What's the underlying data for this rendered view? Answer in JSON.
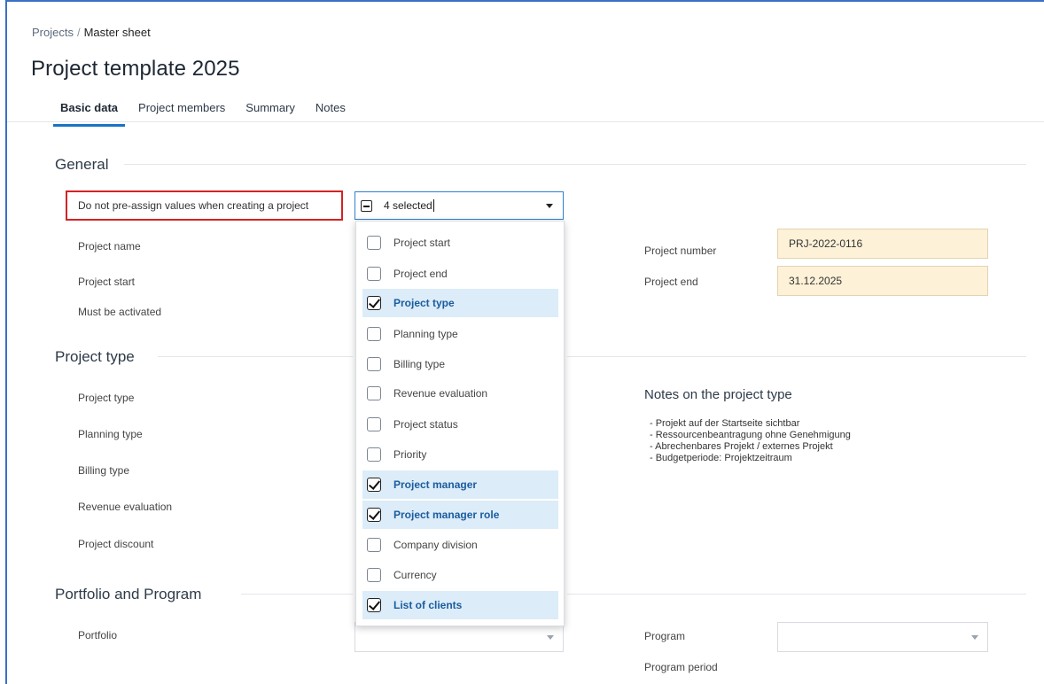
{
  "breadcrumb": {
    "parent": "Projects",
    "separator": "/",
    "current": "Master sheet"
  },
  "page_title": "Project template 2025",
  "tabs": [
    {
      "label": "Basic data",
      "active": true
    },
    {
      "label": "Project members",
      "active": false
    },
    {
      "label": "Summary",
      "active": false
    },
    {
      "label": "Notes",
      "active": false
    }
  ],
  "sections": {
    "general": {
      "title": "General",
      "preassign_label": "Do not pre-assign values when creating a project",
      "preassign_value": "4 selected",
      "project_name_label": "Project name",
      "project_start_label": "Project start",
      "must_be_activated_label": "Must be activated",
      "project_number_label": "Project number",
      "project_number_value": "PRJ-2022-0116",
      "project_end_label": "Project end",
      "project_end_value": "31.12.2025"
    },
    "project_type": {
      "title": "Project type",
      "project_type_label": "Project type",
      "planning_type_label": "Planning type",
      "billing_type_label": "Billing type",
      "revenue_evaluation_label": "Revenue evaluation",
      "project_discount_label": "Project discount",
      "notes_title": "Notes on the project type",
      "notes": [
        "- Projekt auf der Startseite sichtbar",
        "- Ressourcenbeantragung ohne Genehmigung",
        "- Abrechenbares Projekt / externes Projekt",
        "- Budgetperiode: Projektzeitraum"
      ]
    },
    "portfolio": {
      "title": "Portfolio and Program",
      "portfolio_label": "Portfolio",
      "program_label": "Program",
      "program_period_label": "Program period"
    }
  },
  "dropdown_options": [
    {
      "label": "Project start",
      "checked": false
    },
    {
      "label": "Project end",
      "checked": false
    },
    {
      "label": "Project type",
      "checked": true
    },
    {
      "label": "Planning type",
      "checked": false
    },
    {
      "label": "Billing type",
      "checked": false
    },
    {
      "label": "Revenue evaluation",
      "checked": false
    },
    {
      "label": "Project status",
      "checked": false
    },
    {
      "label": "Priority",
      "checked": false
    },
    {
      "label": "Project manager",
      "checked": true
    },
    {
      "label": "Project manager role",
      "checked": true
    },
    {
      "label": "Company division",
      "checked": false
    },
    {
      "label": "Currency",
      "checked": false
    },
    {
      "label": "List of clients",
      "checked": true
    }
  ],
  "colors": {
    "accent": "#1a73c4",
    "highlight_border": "#d42222",
    "readonly_field_bg": "#fdf1d8",
    "selected_option_bg": "#dcecf8"
  }
}
